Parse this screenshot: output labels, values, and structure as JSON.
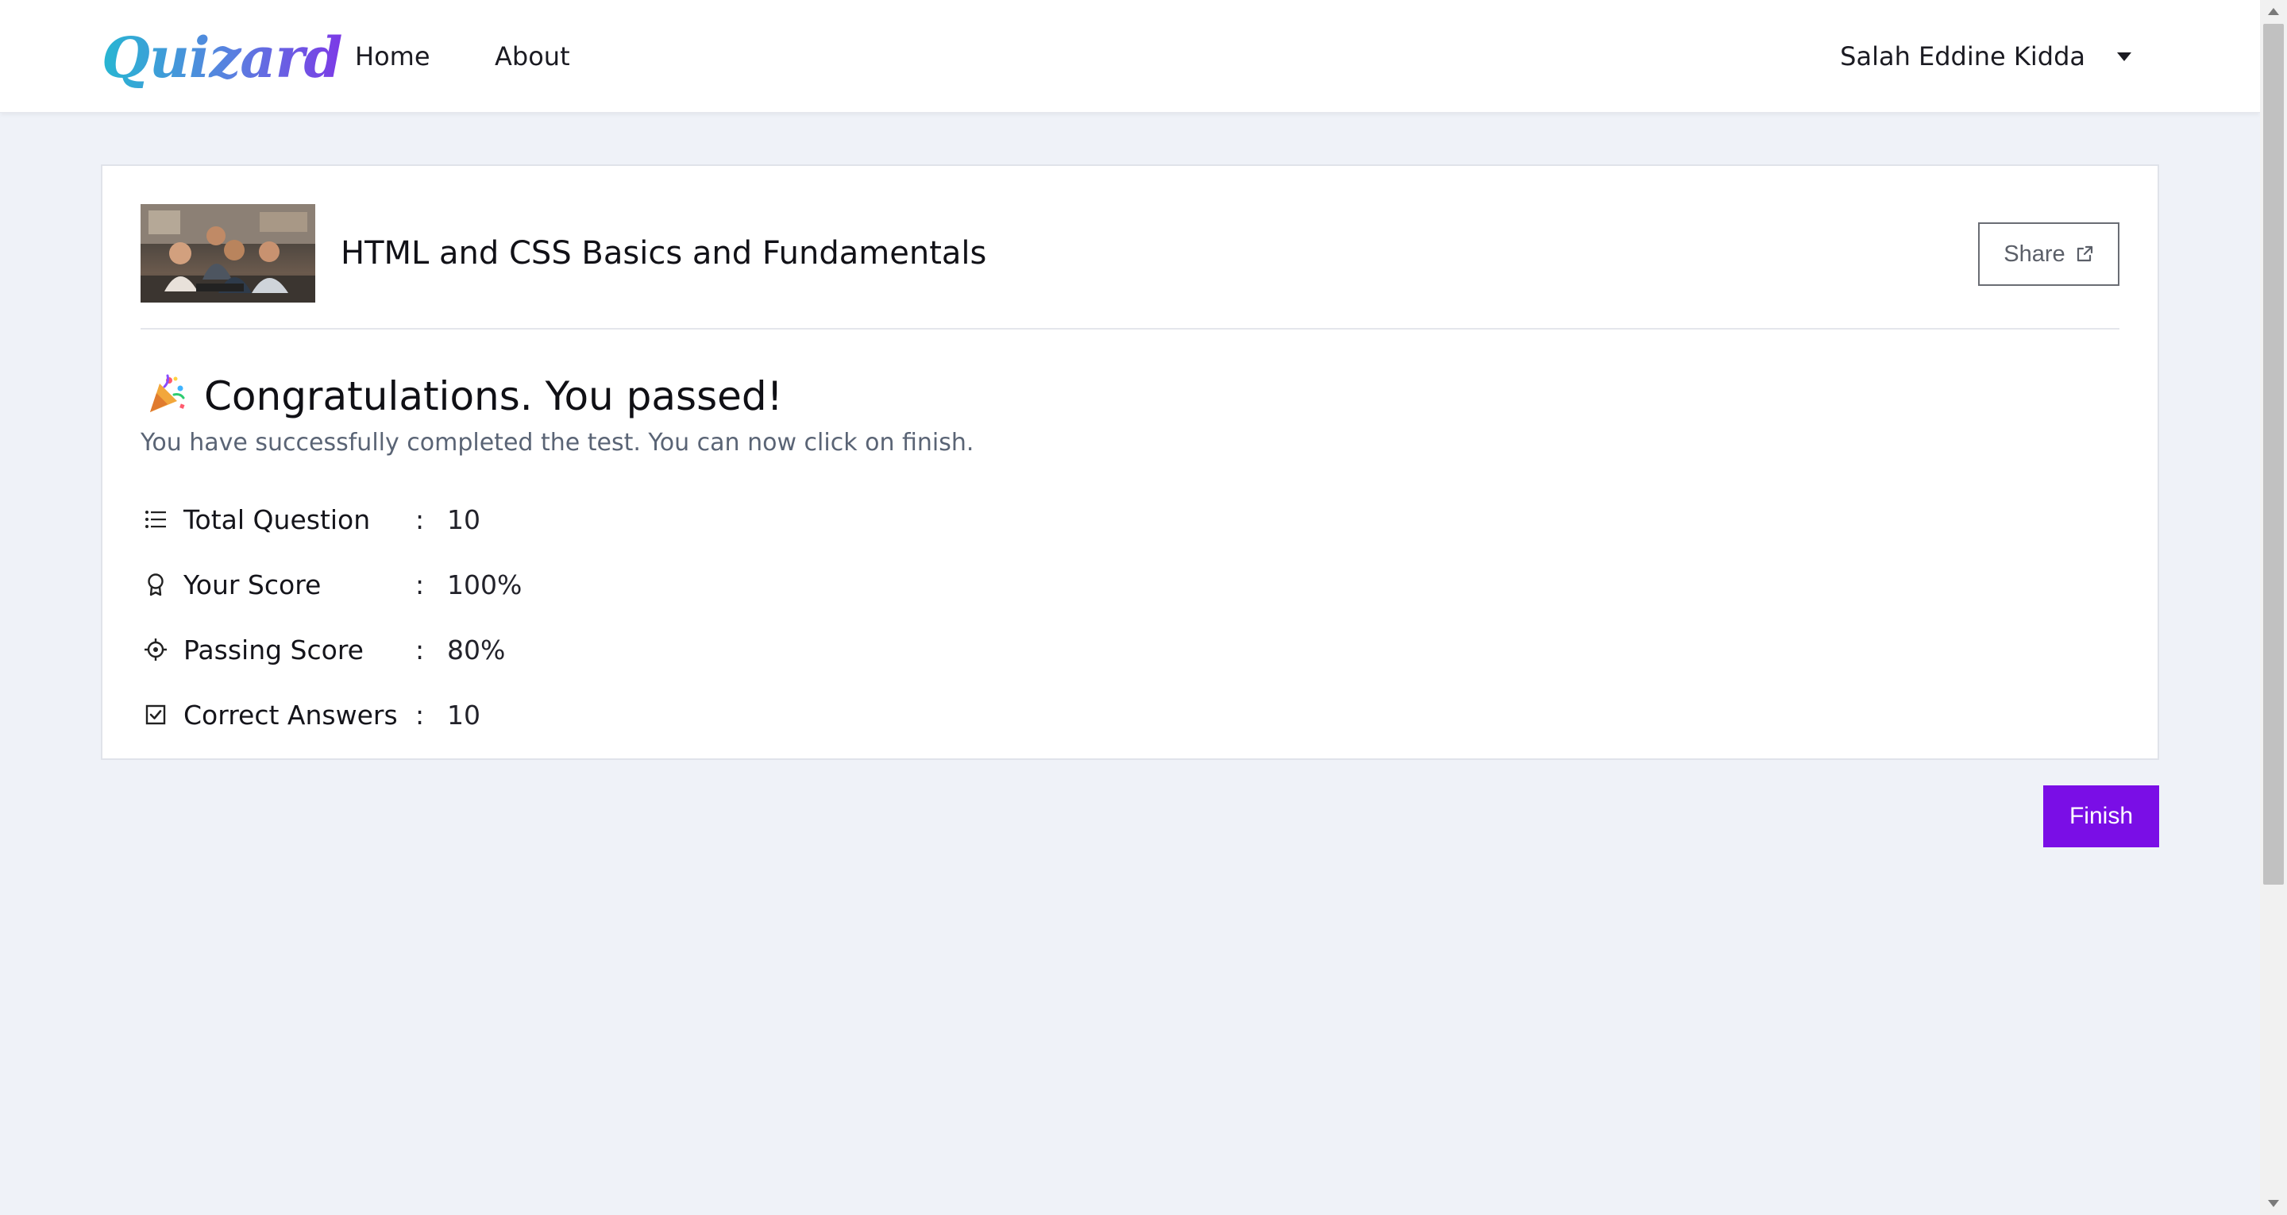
{
  "nav": {
    "logo": "Quizard",
    "links": [
      "Home",
      "About"
    ],
    "user_name": "Salah Eddine Kidda"
  },
  "quiz": {
    "title": "HTML and CSS Basics and Fundamentals",
    "share_label": "Share"
  },
  "result": {
    "emoji": "🎉",
    "heading": "Congratulations. You passed!",
    "message": "You have successfully completed the test. You can now click on finish.",
    "stats": [
      {
        "icon": "list-icon",
        "label": "Total Question",
        "value": "10"
      },
      {
        "icon": "award-icon",
        "label": "Your Score",
        "value": "100%"
      },
      {
        "icon": "target-icon",
        "label": "Passing Score",
        "value": "80%"
      },
      {
        "icon": "check-square-icon",
        "label": "Correct Answers",
        "value": "10"
      }
    ],
    "separator": ":"
  },
  "actions": {
    "finish_label": "Finish"
  },
  "colors": {
    "accent": "#7a0ee6",
    "background": "#eff2f8",
    "logo_start": "#27b6d2",
    "logo_end": "#7c3ae6"
  }
}
